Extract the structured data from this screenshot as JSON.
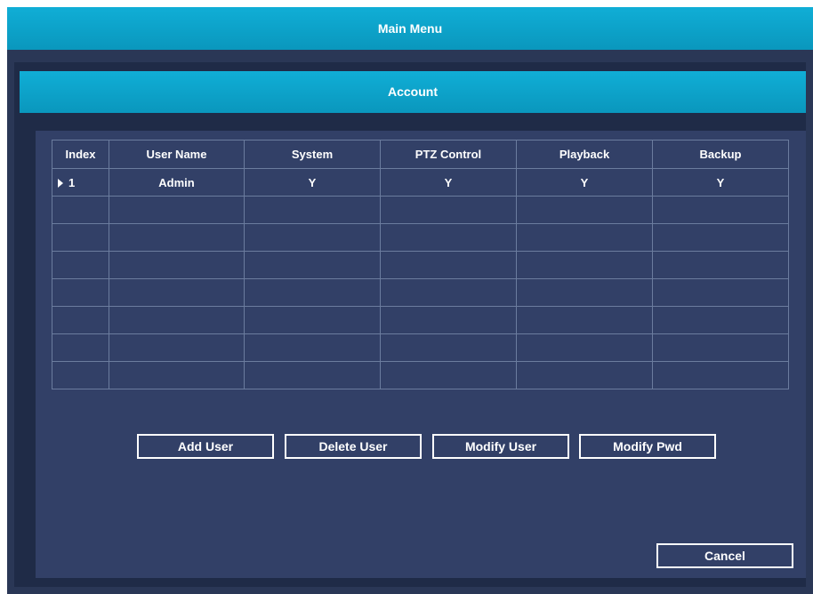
{
  "window": {
    "title": "Main Menu"
  },
  "dialog": {
    "title": "Account"
  },
  "table": {
    "columns": [
      "Index",
      "User Name",
      "System",
      "PTZ Control",
      "Playback",
      "Backup"
    ],
    "rows": [
      {
        "index": "1",
        "user_name": "Admin",
        "system": "Y",
        "ptz_control": "Y",
        "playback": "Y",
        "backup": "Y",
        "selected": true
      }
    ]
  },
  "buttons": {
    "add_user": "Add User",
    "delete_user": "Delete User",
    "modify_user": "Modify User",
    "modify_pwd": "Modify Pwd",
    "cancel": "Cancel"
  },
  "colors": {
    "titlebar": "#0aa3ca",
    "panel": "#324067",
    "frame": "#1f2b47",
    "grid": "#6b7c9e"
  }
}
